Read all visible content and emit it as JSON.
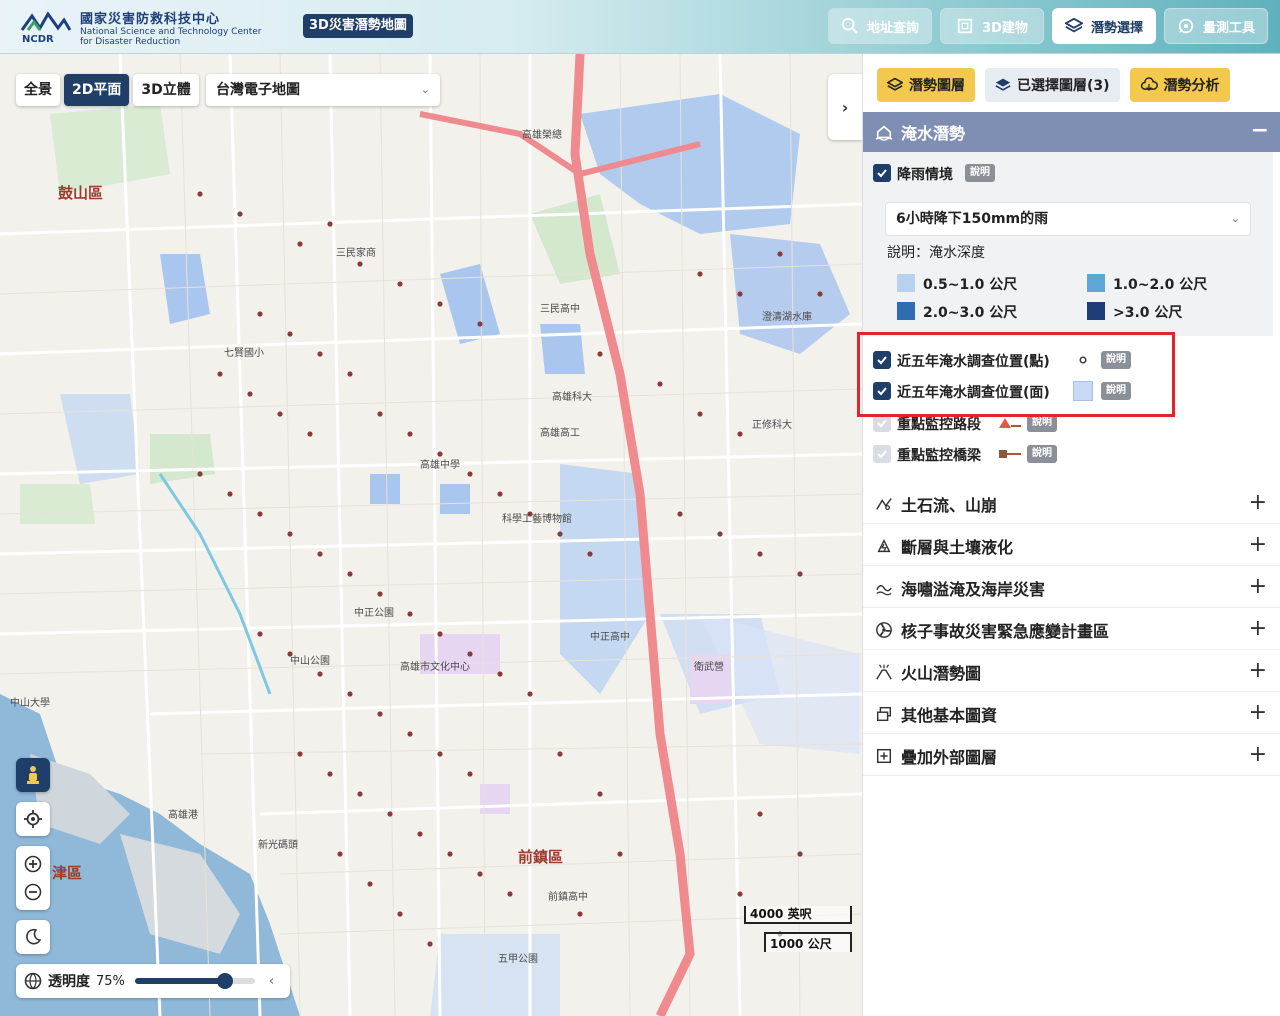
{
  "header": {
    "org_zh": "國家災害防救科技中心",
    "org_en_1": "National Science and Technology Center",
    "org_en_2": "for Disaster Reduction",
    "logo_text": "NCDR",
    "app_badge": "3D災害潛勢地圖",
    "buttons": [
      {
        "label": "地址查詢",
        "icon": "search-icon"
      },
      {
        "label": "3D建物",
        "icon": "building-3d-icon"
      },
      {
        "label": "潛勢選擇",
        "icon": "layers-icon",
        "active": true
      },
      {
        "label": "量測工具",
        "icon": "ruler-icon"
      }
    ]
  },
  "map": {
    "mode_buttons": [
      "全景",
      "2D平面",
      "3D立體"
    ],
    "active_mode": "2D平面",
    "basemap": "台灣電子地圖",
    "opacity_label": "透明度",
    "opacity_value": "75%",
    "opacity_fraction": 0.75,
    "scale_imperial": "4000 英呎",
    "scale_metric": "1000 公尺",
    "districts": [
      "鼓山區",
      "前鎮區",
      "津區"
    ],
    "places": [
      "高雄榮總",
      "三民家商",
      "三民高中",
      "高雄科大",
      "正修科大",
      "高雄高工",
      "科學工藝博物館",
      "高雄中學",
      "中正公園",
      "高雄市文化中心",
      "高雄港",
      "新光碼頭",
      "中山大學",
      "衛武營",
      "前鎮高中",
      "五甲公園",
      "中正高中",
      "七賢國小",
      "中山公園",
      "澄清湖水庫"
    ]
  },
  "panel": {
    "tabs": [
      {
        "label": "潛勢圖層",
        "icon": "layers-icon"
      },
      {
        "label": "已選擇圖層(3)",
        "icon": "stack-check-icon"
      },
      {
        "label": "潛勢分析",
        "icon": "cloud-icon"
      }
    ],
    "flood_section": {
      "title": "淹水潛勢",
      "rain_label": "降雨情境",
      "explain": "說明",
      "scenario": "6小時降下150mm的雨",
      "depth_note": "說明：淹水深度",
      "legend": [
        {
          "label": "0.5~1.0 公尺",
          "color": "#b8d2ee"
        },
        {
          "label": "1.0~2.0 公尺",
          "color": "#5ea6d6"
        },
        {
          "label": "2.0~3.0 公尺",
          "color": "#2f6db3"
        },
        {
          "label": ">3.0 公尺",
          "color": "#1f3e78"
        }
      ],
      "survey_points": "近五年淹水調查位置(點)",
      "survey_areas": "近五年淹水調查位置(面)",
      "monitor_roads": "重點監控路段",
      "monitor_bridges": "重點監控橋梁"
    },
    "sections": [
      {
        "title": "土石流、山崩",
        "icon": "landslide-icon"
      },
      {
        "title": "斷層與土壤液化",
        "icon": "fault-icon"
      },
      {
        "title": "海嘯溢淹及海岸災害",
        "icon": "wave-icon"
      },
      {
        "title": "核子事故災害緊急應變計畫區",
        "icon": "radiation-icon"
      },
      {
        "title": "火山潛勢圖",
        "icon": "volcano-icon"
      },
      {
        "title": "其他基本圖資",
        "icon": "map-layer-icon"
      },
      {
        "title": "疊加外部圖層",
        "icon": "add-layer-icon"
      }
    ]
  }
}
